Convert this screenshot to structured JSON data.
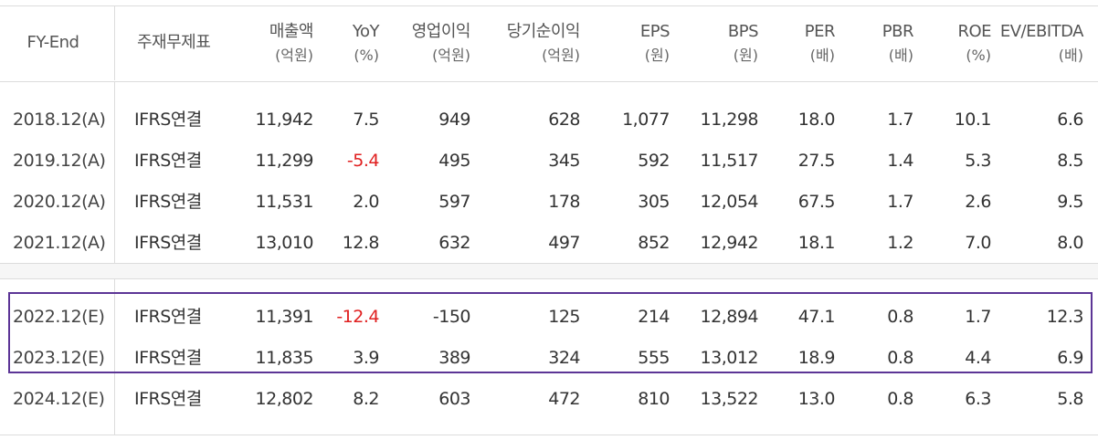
{
  "columns": [
    {
      "label": "FY-End",
      "unit": ""
    },
    {
      "label": "주재무제표",
      "unit": ""
    },
    {
      "label": "매출액",
      "unit": "(억원)"
    },
    {
      "label": "YoY",
      "unit": "(%)"
    },
    {
      "label": "영업이익",
      "unit": "(억원)"
    },
    {
      "label": "당기순이익",
      "unit": "(억원)"
    },
    {
      "label": "EPS",
      "unit": "(원)"
    },
    {
      "label": "BPS",
      "unit": "(원)"
    },
    {
      "label": "PER",
      "unit": "(배)"
    },
    {
      "label": "PBR",
      "unit": "(배)"
    },
    {
      "label": "ROE",
      "unit": "(%)"
    },
    {
      "label": "EV/EBITDA",
      "unit": "(배)"
    }
  ],
  "rows": [
    {
      "fy": "2018.12(A)",
      "basis": "IFRS연결",
      "sales": "11,942",
      "yoy": "7.5",
      "op": "949",
      "net": "628",
      "eps": "1,077",
      "bps": "11,298",
      "per": "18.0",
      "pbr": "1.7",
      "roe": "10.1",
      "ev": "6.6"
    },
    {
      "fy": "2019.12(A)",
      "basis": "IFRS연결",
      "sales": "11,299",
      "yoy": "-5.4",
      "op": "495",
      "net": "345",
      "eps": "592",
      "bps": "11,517",
      "per": "27.5",
      "pbr": "1.4",
      "roe": "5.3",
      "ev": "8.5"
    },
    {
      "fy": "2020.12(A)",
      "basis": "IFRS연결",
      "sales": "11,531",
      "yoy": "2.0",
      "op": "597",
      "net": "178",
      "eps": "305",
      "bps": "12,054",
      "per": "67.5",
      "pbr": "1.7",
      "roe": "2.6",
      "ev": "9.5"
    },
    {
      "fy": "2021.12(A)",
      "basis": "IFRS연결",
      "sales": "13,010",
      "yoy": "12.8",
      "op": "632",
      "net": "497",
      "eps": "852",
      "bps": "12,942",
      "per": "18.1",
      "pbr": "1.2",
      "roe": "7.0",
      "ev": "8.0"
    },
    {
      "fy": "2022.12(E)",
      "basis": "IFRS연결",
      "sales": "11,391",
      "yoy": "-12.4",
      "op": "-150",
      "net": "125",
      "eps": "214",
      "bps": "12,894",
      "per": "47.1",
      "pbr": "0.8",
      "roe": "1.7",
      "ev": "12.3"
    },
    {
      "fy": "2023.12(E)",
      "basis": "IFRS연결",
      "sales": "11,835",
      "yoy": "3.9",
      "op": "389",
      "net": "324",
      "eps": "555",
      "bps": "13,012",
      "per": "18.9",
      "pbr": "0.8",
      "roe": "4.4",
      "ev": "6.9"
    },
    {
      "fy": "2024.12(E)",
      "basis": "IFRS연결",
      "sales": "12,802",
      "yoy": "8.2",
      "op": "603",
      "net": "472",
      "eps": "810",
      "bps": "13,522",
      "per": "13.0",
      "pbr": "0.8",
      "roe": "6.3",
      "ev": "5.8"
    }
  ],
  "colors": {
    "negative": "#e02020",
    "highlight_border": "#5c3596",
    "grid": "#dcdcdc"
  }
}
